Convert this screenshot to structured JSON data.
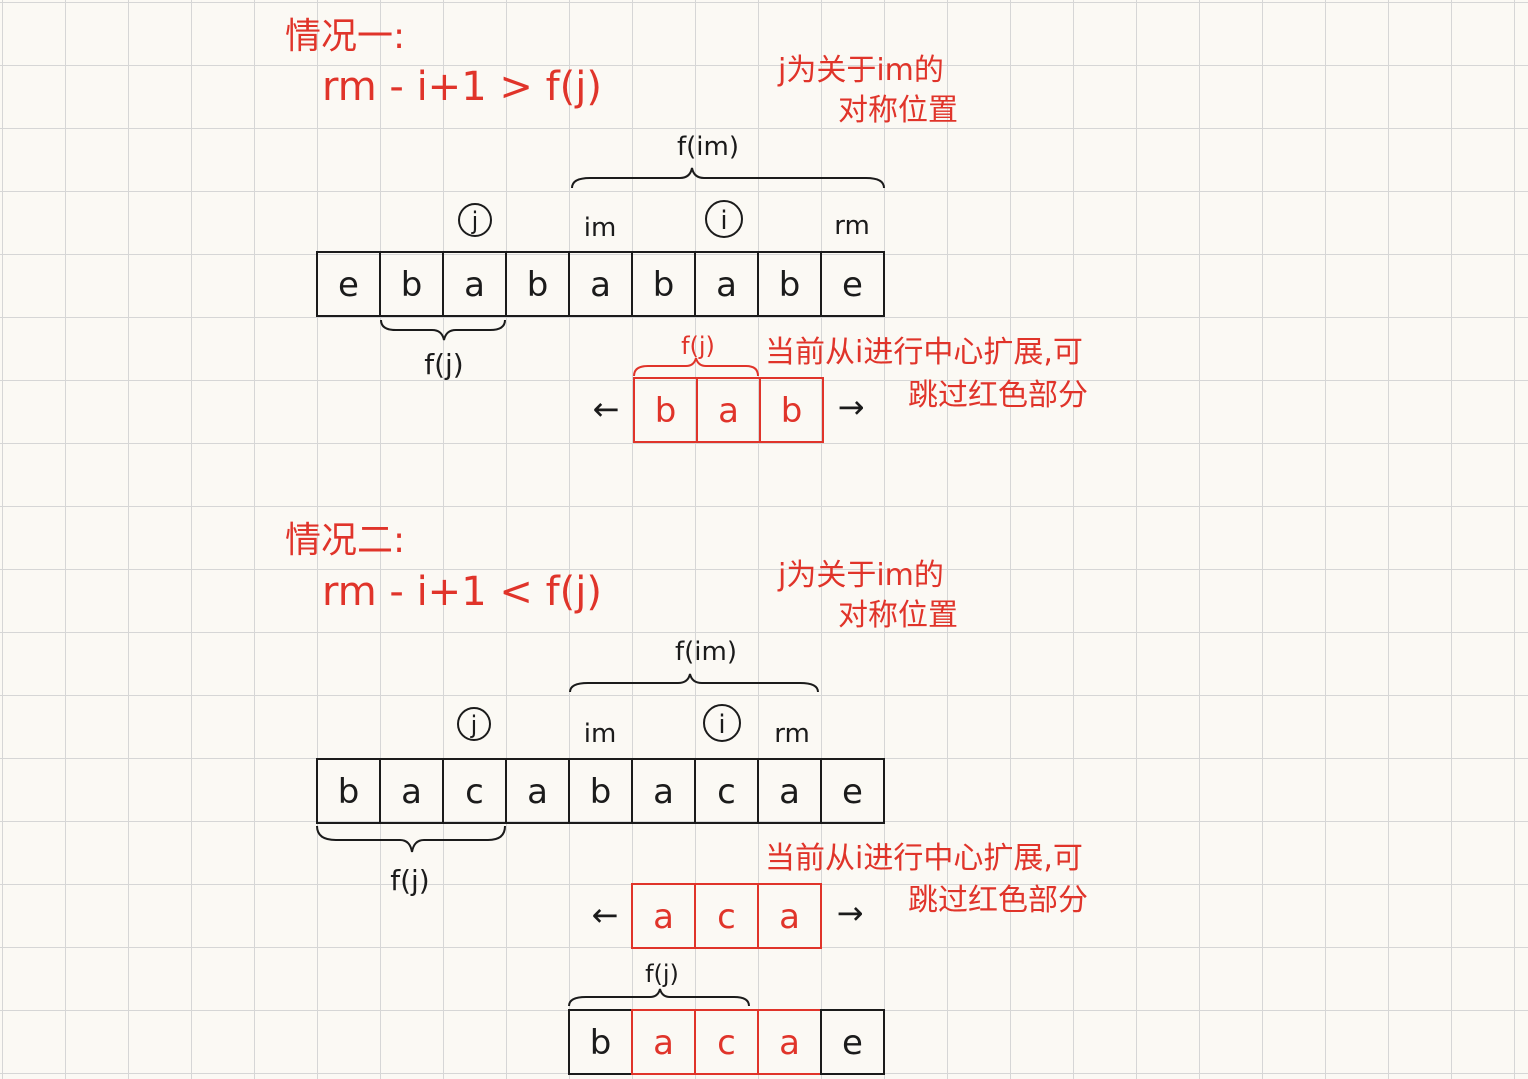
{
  "colors": {
    "ink": "#1b1b1b",
    "red": "#e0342a"
  },
  "case1": {
    "title": "情况一:",
    "condition": "rm - i+1 > f(j)",
    "note_line1": "j为关于im的",
    "note_line2": "对称位置",
    "brace_top": "f(im)",
    "marker_j": "j",
    "marker_im": "im",
    "marker_i": "i",
    "marker_rm": "rm",
    "cells": [
      "e",
      "b",
      "a",
      "b",
      "a",
      "b",
      "a",
      "b",
      "e"
    ],
    "brace_bottom": "f(j)",
    "red_brace": "f(j)",
    "red_cells": [
      "b",
      "a",
      "b"
    ],
    "left_arrow": "←",
    "right_arrow": "→",
    "expand_line1": "当前从i进行中心扩展,可",
    "expand_line2": "跳过红色部分"
  },
  "case2": {
    "title": "情况二:",
    "condition": "rm - i+1 < f(j)",
    "note_line1": "j为关于im的",
    "note_line2": "对称位置",
    "brace_top": "f(im)",
    "marker_j": "j",
    "marker_im": "im",
    "marker_i": "i",
    "marker_rm": "rm",
    "cells": [
      "b",
      "a",
      "c",
      "a",
      "b",
      "a",
      "c",
      "a",
      "e"
    ],
    "brace_bottom": "f(j)",
    "red_cells": [
      "a",
      "c",
      "a"
    ],
    "left_arrow": "←",
    "right_arrow": "→",
    "expand_line1": "当前从i进行中心扩展,可",
    "expand_line2": "跳过红色部分",
    "bottom_brace": "f(j)",
    "bottom_cells": [
      "b",
      "a",
      "c",
      "a",
      "e"
    ],
    "bottom_red_indices": [
      1,
      2,
      3
    ]
  }
}
